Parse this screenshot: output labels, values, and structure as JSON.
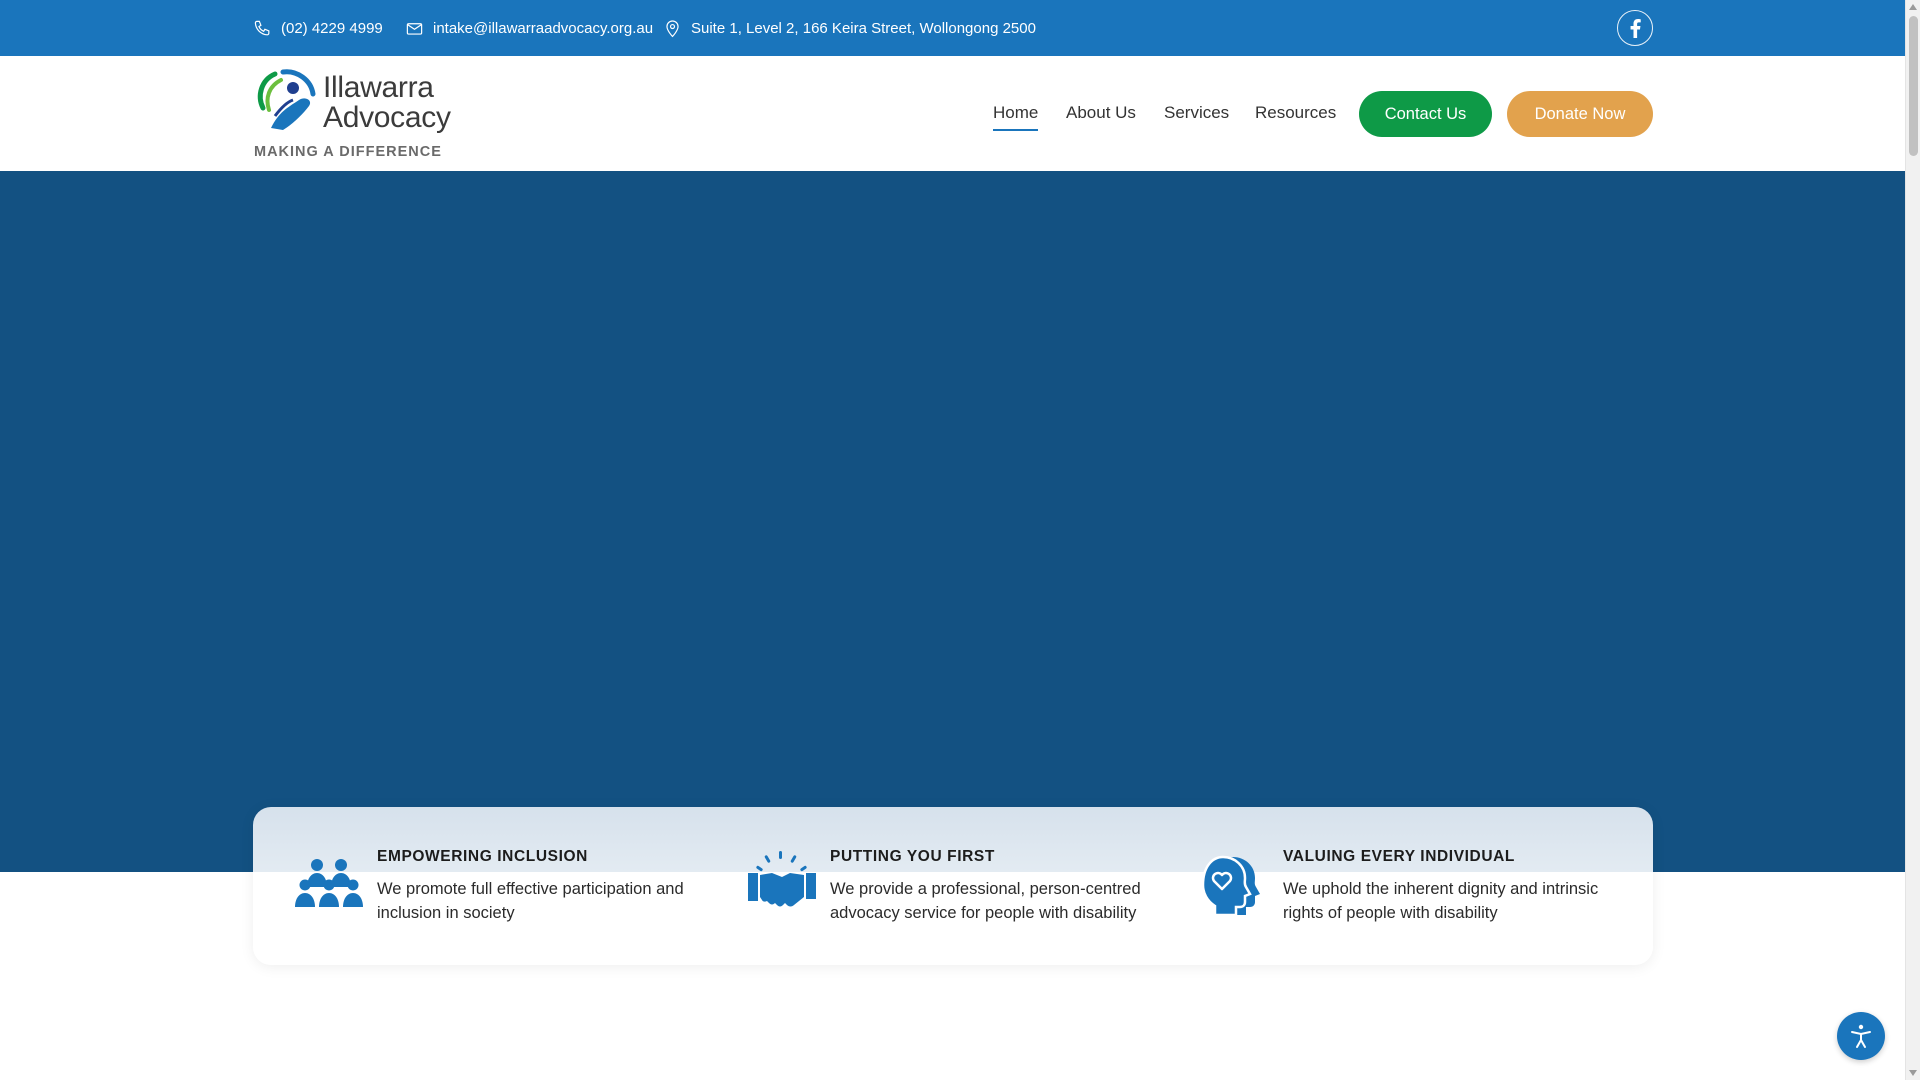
{
  "topbar": {
    "phone": "(02) 4229 4999",
    "email": "intake@illawarraadvocacy.org.au",
    "address": "Suite 1, Level 2, 166 Keira Street, Wollongong 2500",
    "social_icon": "facebook-icon"
  },
  "logo": {
    "line1": "Illawarra",
    "line2": "Advocacy",
    "tagline": "MAKING A DIFFERENCE"
  },
  "nav": {
    "items": [
      {
        "label": "Home",
        "active": true
      },
      {
        "label": "About Us",
        "active": false
      },
      {
        "label": "Services",
        "active": false
      },
      {
        "label": "Resources",
        "active": false
      }
    ],
    "contact_label": "Contact Us",
    "donate_label": "Donate Now"
  },
  "features": [
    {
      "icon": "group-people-icon",
      "heading": "EMPOWERING INCLUSION",
      "text": "We promote full effective participation and inclusion in society"
    },
    {
      "icon": "handshake-icon",
      "heading": "PUTTING YOU FIRST",
      "text": "We provide a professional, person-centred advocacy service for people with disability"
    },
    {
      "icon": "heads-heart-icon",
      "heading": "VALUING EVERY INDIVIDUAL",
      "text": "We uphold the inherent dignity and intrinsic rights of people with disability"
    }
  ],
  "colors": {
    "topbar": "#1a75bc",
    "hero": "#135182",
    "contact_button": "#0e9a47",
    "donate_button": "#e2a24d",
    "icon_blue": "#1a75bc"
  },
  "accessibility_icon": "accessibility-icon"
}
